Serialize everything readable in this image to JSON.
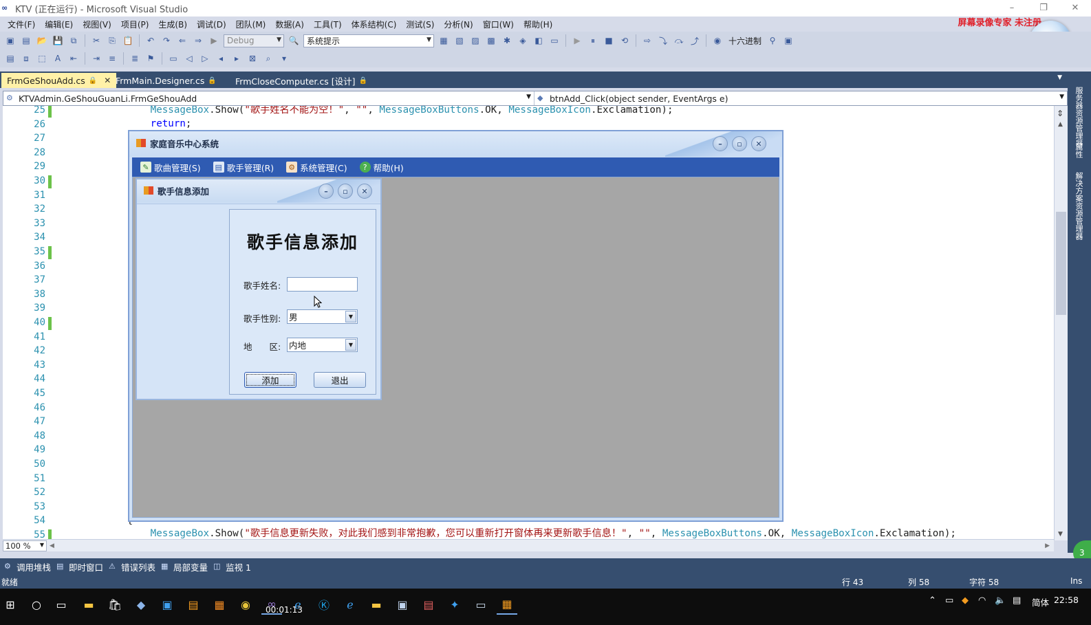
{
  "vs": {
    "window_title": "KTV (正在运行) - Microsoft Visual Studio",
    "logo": "∞",
    "window_buttons": [
      "–",
      "❐",
      "✕"
    ],
    "watermark": "屏幕录像专家 未注册",
    "menu": [
      "文件(F)",
      "编辑(E)",
      "视图(V)",
      "项目(P)",
      "生成(B)",
      "调试(D)",
      "团队(M)",
      "数据(A)",
      "工具(T)",
      "体系结构(C)",
      "测试(S)",
      "分析(N)",
      "窗口(W)",
      "帮助(H)"
    ],
    "toolbar": {
      "config": "Debug",
      "platform": "系统提示",
      "hex_label": "十六进制"
    },
    "tabs": [
      {
        "label": "FrmGeShouAdd.cs",
        "lock": "🔒",
        "close": "✕",
        "active": true
      },
      {
        "label": "FrmMain.Designer.cs",
        "lock": "🔒",
        "active": false
      },
      {
        "label": "FrmCloseComputer.cs [设计]",
        "lock": "🔒",
        "active": false
      }
    ],
    "nav": {
      "class_path": "KTVAdmin.GeShouGuanLi.FrmGeShouAdd",
      "member": "btnAdd_Click(object sender, EventArgs e)"
    },
    "editor": {
      "line_numbers": [
        "25",
        "26",
        "27",
        "28",
        "29",
        "30",
        "31",
        "32",
        "33",
        "34",
        "35",
        "36",
        "37",
        "38",
        "39",
        "40",
        "41",
        "42",
        "43",
        "44",
        "45",
        "46",
        "47",
        "48",
        "49",
        "50",
        "51",
        "52",
        "53",
        "54",
        "55"
      ],
      "changed_lines": [
        "25",
        "30",
        "35",
        "40",
        "55"
      ],
      "code_line_25": {
        "indent": "                ",
        "t1": "MessageBox",
        "t2": ".Show(",
        "s1": "\"歌手姓名不能为空！\"",
        "t3": ", ",
        "s2": "\"\"",
        "t4": ", ",
        "t5": "MessageBoxButtons",
        "t6": ".OK, ",
        "t7": "MessageBoxIcon",
        "t8": ".Exclamation);"
      },
      "code_line_26": {
        "indent": "                ",
        "kw": "return",
        "rest": ";"
      },
      "code_line_54": {
        "indent": "            ",
        "text": "{"
      },
      "code_line_55": {
        "indent": "                ",
        "t1": "MessageBox",
        "t2": ".Show(",
        "s1": "\"歌手信息更新失败，对此我们感到非常抱歉，您可以重新打开窗体再来更新歌手信息！\"",
        "t3": ", ",
        "s2": "\"\"",
        "t4": ", ",
        "t5": "MessageBoxButtons",
        "t6": ".OK, ",
        "t7": "MessageBoxIcon",
        "t8": ".Exclamation);"
      },
      "zoom": "100 %"
    },
    "right_strip": [
      "服务器资源管理器",
      "属性",
      "解决方案资源管理器"
    ],
    "green_badge": "3",
    "tool_tabs": [
      "调用堆栈",
      "即时窗口",
      "错误列表",
      "局部变量",
      "监视 1"
    ],
    "status": {
      "ready": "就绪",
      "line": "行 43",
      "col": "列 58",
      "ch": "字符 58",
      "mode": "Ins"
    }
  },
  "taskbar": {
    "timer": "00:01:13",
    "ime": "简体",
    "clock": "22:58"
  },
  "app": {
    "title": "家庭音乐中心系统",
    "menu": [
      {
        "label": "歌曲管理(S)",
        "icon": "music-icon"
      },
      {
        "label": "歌手管理(R)",
        "icon": "singer-icon"
      },
      {
        "label": "系统管理(C)",
        "icon": "system-icon"
      },
      {
        "label": "帮助(H)",
        "icon": "help-icon"
      }
    ],
    "caption_buttons": [
      "–",
      "▫",
      "✕"
    ]
  },
  "child": {
    "title": "歌手信息添加",
    "heading": "歌手信息添加",
    "fields": {
      "name_label": "歌手姓名:",
      "name_value": "",
      "gender_label": "歌手性别:",
      "gender_value": "男",
      "region_label": "地　　区:",
      "region_value": "内地"
    },
    "buttons": {
      "add": "添加",
      "exit": "退出"
    }
  },
  "colors": {
    "vs_frame": "#364e6f",
    "active_tab": "#fff1a8",
    "keyword": "#0000ff",
    "type": "#2b91af",
    "string": "#a31515",
    "change_marker": "#6cc24a",
    "app_menu": "#2f5bb2",
    "mdi_client": "#a6a6a6"
  }
}
